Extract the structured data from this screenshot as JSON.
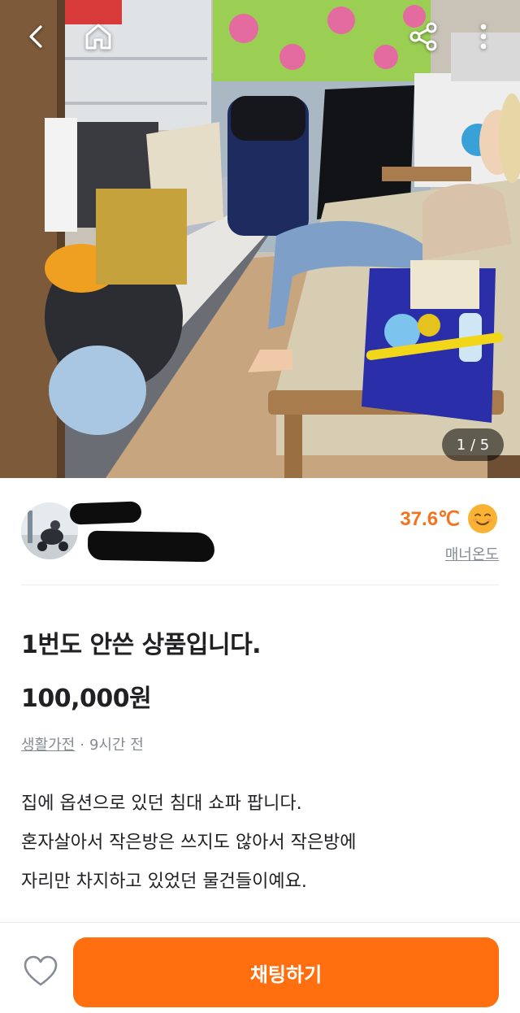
{
  "photo": {
    "counter": "1 / 5"
  },
  "nav": {
    "back_icon": "chevron-left-icon",
    "home_icon": "home-icon",
    "share_icon": "share-icon",
    "more_icon": "more-vertical-icon"
  },
  "seller": {
    "temperature": "37.6℃",
    "temperature_color": "#f27421",
    "manner_label": "매너온도"
  },
  "article": {
    "title": "1번도 안쓴 상품입니다.",
    "price": "100,000원",
    "category": "생활가전",
    "separator": "·",
    "time": "9시간 전",
    "description": [
      "집에 옵션으로 있던 침대 쇼파 팝니다.",
      "혼자살아서 작은방은 쓰지도 않아서 작은방에",
      "자리만 차지하고 있었던 물건들이예요."
    ]
  },
  "bottom": {
    "chat_label": "채팅하기",
    "chat_color": "#ff6f0f",
    "like_icon": "heart-outline-icon"
  }
}
